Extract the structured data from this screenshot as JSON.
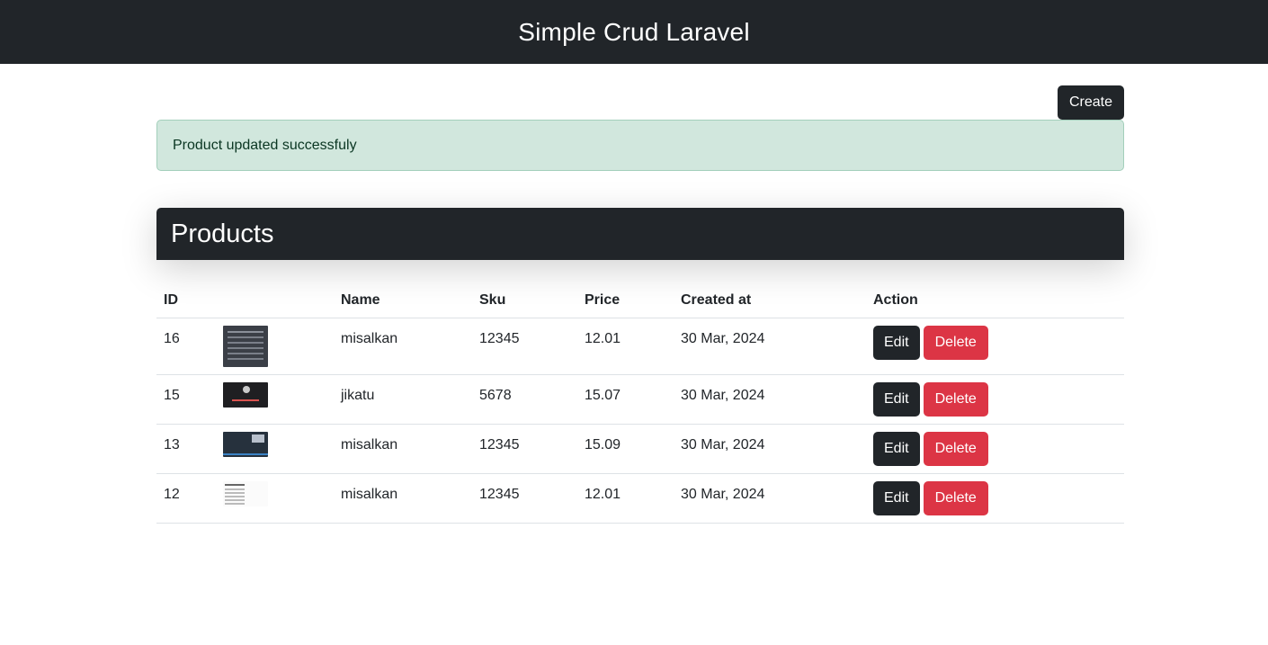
{
  "header": {
    "title": "Simple Crud Laravel"
  },
  "toolbar": {
    "create_label": "Create"
  },
  "alert": {
    "message": "Product updated successfuly"
  },
  "card": {
    "title": "Products"
  },
  "table": {
    "columns": [
      "ID",
      "",
      "Name",
      "Sku",
      "Price",
      "Created at",
      "Action"
    ],
    "rows": [
      {
        "id": "16",
        "name": "misalkan",
        "sku": "12345",
        "price": "12.01",
        "created_at": "30 Mar, 2024",
        "edit_label": "Edit",
        "delete_label": "Delete"
      },
      {
        "id": "15",
        "name": "jikatu",
        "sku": "5678",
        "price": "15.07",
        "created_at": "30 Mar, 2024",
        "edit_label": "Edit",
        "delete_label": "Delete"
      },
      {
        "id": "13",
        "name": "misalkan",
        "sku": "12345",
        "price": "15.09",
        "created_at": "30 Mar, 2024",
        "edit_label": "Edit",
        "delete_label": "Delete"
      },
      {
        "id": "12",
        "name": "misalkan",
        "sku": "12345",
        "price": "12.01",
        "created_at": "30 Mar, 2024",
        "edit_label": "Edit",
        "delete_label": "Delete"
      }
    ]
  },
  "colors": {
    "dark": "#212529",
    "danger": "#dc3545",
    "success_bg": "#d1e7dd",
    "success_border": "#a3cfbb"
  }
}
